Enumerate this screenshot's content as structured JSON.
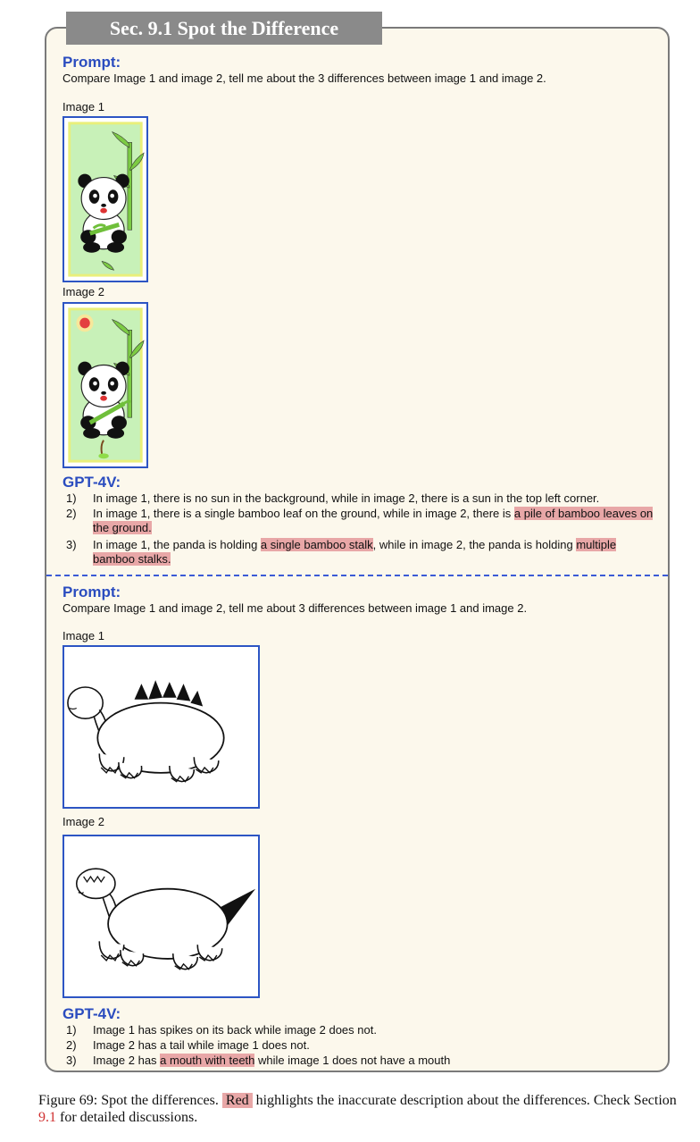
{
  "section_title": "Sec. 9.1 Spot the Difference",
  "example1": {
    "prompt_heading": "Prompt:",
    "prompt_text": "Compare Image 1 and image 2, tell me about the 3 differences between image 1 and image 2.",
    "image1_label": "Image 1",
    "image2_label": "Image 2",
    "response_heading": "GPT-4V:",
    "items": [
      {
        "num": "1)",
        "parts": [
          {
            "t": "In image 1, there is no sun in the background, while in image 2, there is a sun in the top left corner.",
            "hl": false
          }
        ]
      },
      {
        "num": "2)",
        "parts": [
          {
            "t": "In image 1, there is a single bamboo leaf on the ground, while in image 2, there is ",
            "hl": false
          },
          {
            "t": "a pile of bamboo leaves on the ground.",
            "hl": true
          }
        ]
      },
      {
        "num": "3)",
        "parts": [
          {
            "t": "In image 1, the panda is holding ",
            "hl": false
          },
          {
            "t": "a single bamboo stalk",
            "hl": true
          },
          {
            "t": ", while in image 2, the panda is holding ",
            "hl": false
          },
          {
            "t": "multiple bamboo stalks.",
            "hl": true
          }
        ]
      }
    ]
  },
  "example2": {
    "prompt_heading": "Prompt:",
    "prompt_text": "Compare Image 1 and image 2, tell me about 3 differences between image 1 and image 2.",
    "image1_label": "Image 1",
    "image2_label": "Image 2",
    "response_heading": "GPT-4V:",
    "items": [
      {
        "num": "1)",
        "parts": [
          {
            "t": "Image 1 has spikes on its back while image 2 does not.",
            "hl": false
          }
        ]
      },
      {
        "num": "2)",
        "parts": [
          {
            "t": "Image 2 has a tail while image 1 does not.",
            "hl": false
          }
        ]
      },
      {
        "num": "3)",
        "parts": [
          {
            "t": "Image 2 has ",
            "hl": false
          },
          {
            "t": "a mouth with teeth",
            "hl": true
          },
          {
            "t": " while image 1 does not have a mouth",
            "hl": false
          }
        ]
      }
    ]
  },
  "caption": {
    "prefix": "Figure 69: Spot the differences. ",
    "red_tag": "Red",
    "middle": " highlights the inaccurate description about the differences. Check Section ",
    "section_ref": "9.1",
    "suffix": " for detailed discussions."
  },
  "colors": {
    "panel_bg": "#fcf8ec",
    "heading_blue": "#2a4cbf",
    "highlight": "#e8a7a7",
    "image_border": "#2d55c4",
    "title_bg": "#8a8a8a"
  }
}
